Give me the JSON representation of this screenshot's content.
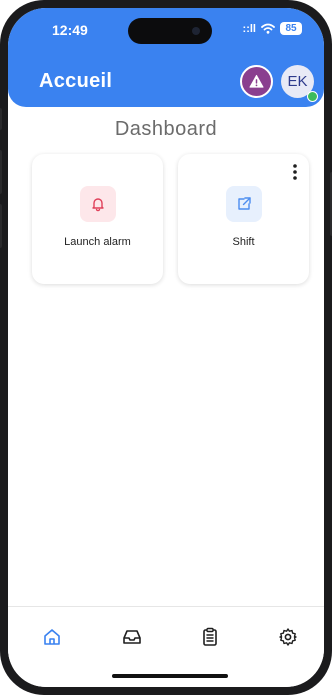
{
  "status_bar": {
    "time": "12:49",
    "signal": "::ll",
    "battery": "85"
  },
  "header": {
    "title": "Accueil",
    "user_initials": "EK"
  },
  "main": {
    "title": "Dashboard",
    "cards": [
      {
        "label": "Launch alarm",
        "icon": "bell-icon"
      },
      {
        "label": "Shift",
        "icon": "external-link-icon"
      }
    ]
  },
  "bottom_nav": {
    "items": [
      {
        "icon": "home-icon",
        "active": true
      },
      {
        "icon": "inbox-icon",
        "active": false
      },
      {
        "icon": "clipboard-icon",
        "active": false
      },
      {
        "icon": "gear-icon",
        "active": false
      }
    ]
  },
  "colors": {
    "primary": "#3a82f0",
    "alert_avatar": "#8a3f8f",
    "alarm_accent": "#e0405a",
    "alarm_bg": "#fde7ea",
    "shift_accent": "#4c8df0",
    "shift_bg": "#e7f0fd",
    "online": "#3dbb5b"
  }
}
